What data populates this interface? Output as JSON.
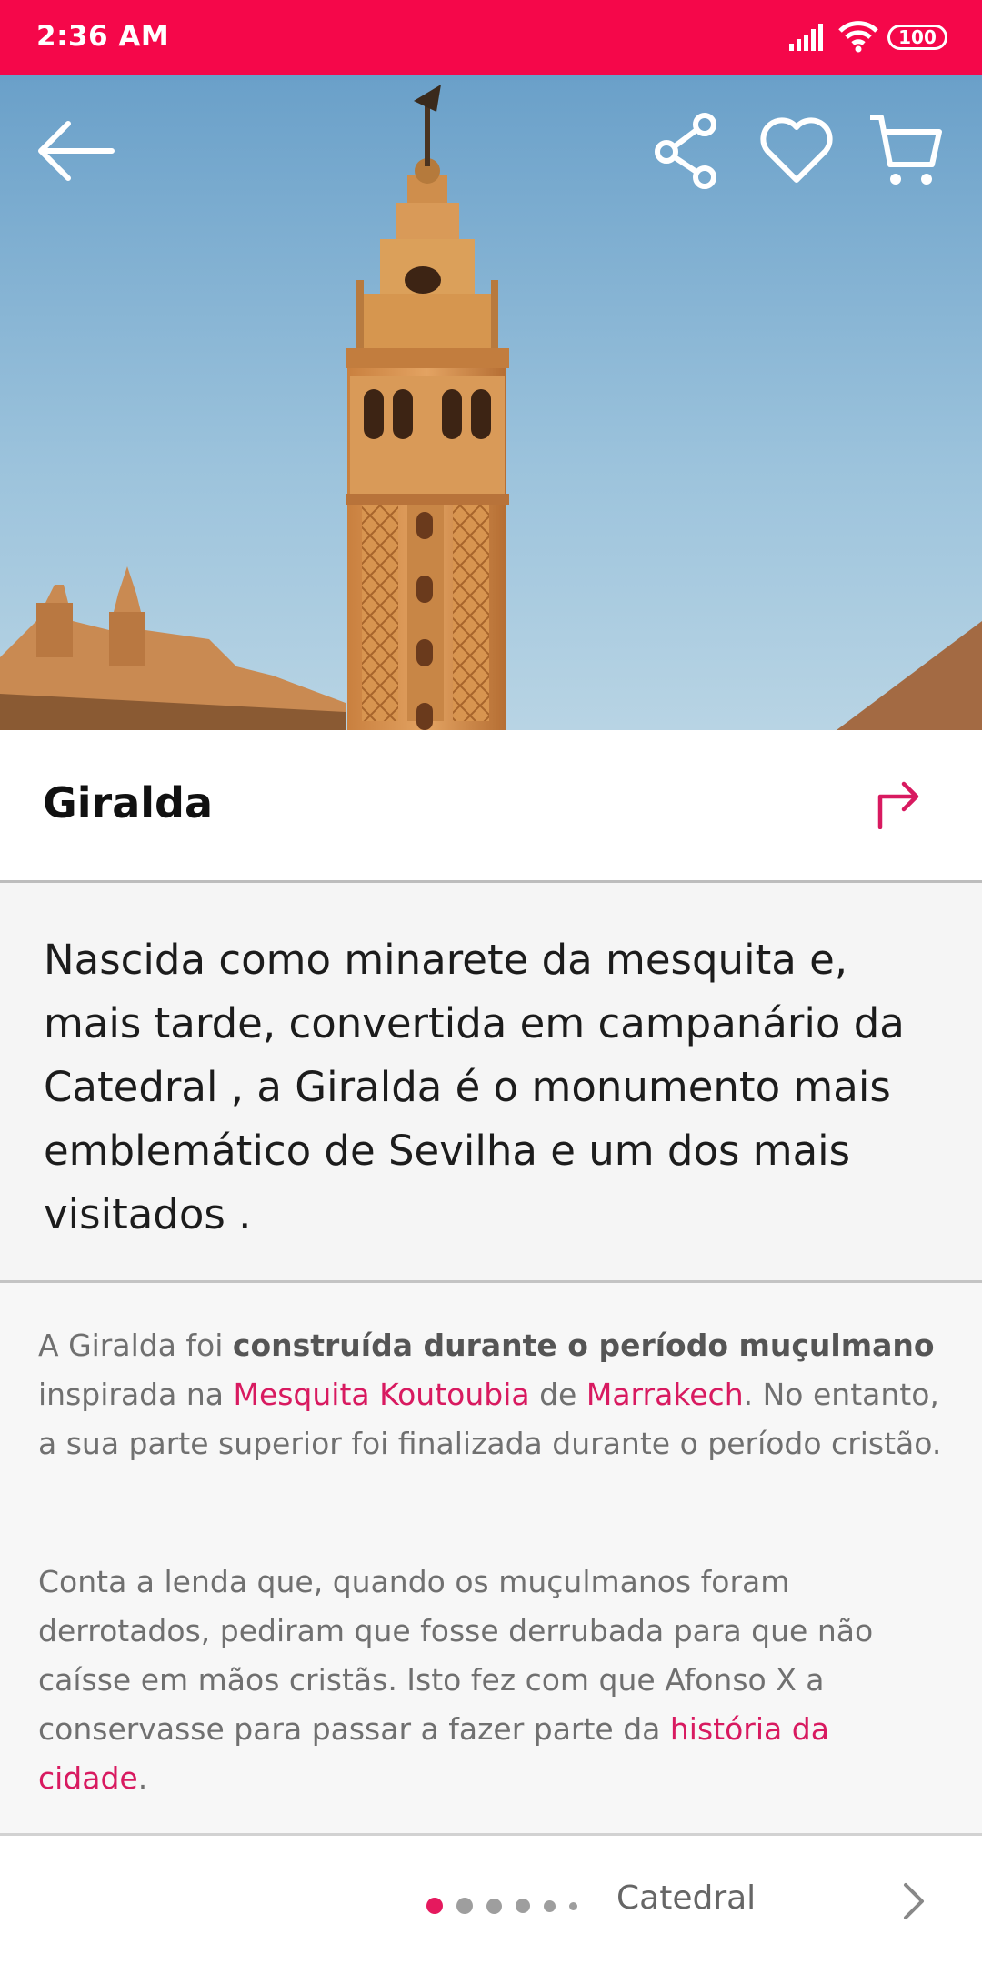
{
  "status_bar": {
    "time": "2:36 AM",
    "battery": "100"
  },
  "header": {
    "back_icon": "arrow-left-icon",
    "share_icon": "share-icon",
    "favorite_icon": "heart-icon",
    "cart_icon": "cart-icon"
  },
  "place": {
    "title": "Giralda",
    "directions_icon": "turn-right-icon"
  },
  "intro": {
    "text": "Nascida como minarete da mesquita e, mais tarde, convertida em  campanário da Catedral  , a Giralda  é o monumento mais emblemático de Sevilha e um dos mais visitados ."
  },
  "body": {
    "p1": {
      "a": "A Giralda foi ",
      "bold": "construída durante o período muçulmano",
      "b": " inspirada na ",
      "link1": "Mesquita Koutoubia",
      "c": " de ",
      "link2": "Marrakech",
      "d": ". No entanto, a sua parte superior foi finalizada durante o período cristão."
    },
    "p2": {
      "a": "Conta a lenda que, quando os muçulmanos foram derrotados, pediram que fosse derrubada para que não caísse em mãos cristãs. Isto fez com que Afonso X a conservasse para passar a fazer parte da ",
      "link": "história da cidade",
      "b": "."
    }
  },
  "pager": {
    "next_label": "Catedral",
    "active_index": 1,
    "total_dots": 6
  },
  "colors": {
    "accent": "#f5074a",
    "link": "#d81a60",
    "sky_top": "#6aa0c9",
    "tower": "#d8924b"
  }
}
